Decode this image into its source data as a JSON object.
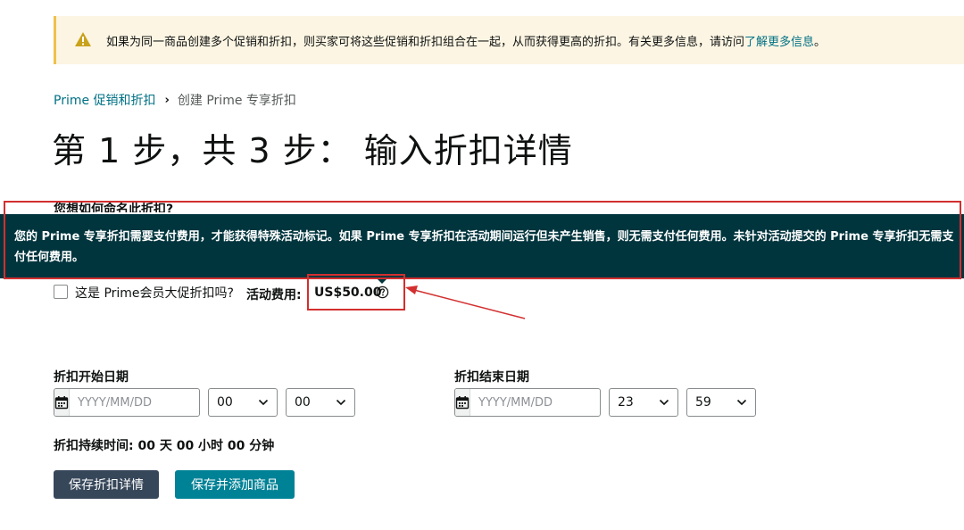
{
  "alert": {
    "text": "如果为同一商品创建多个促销和折扣，则买家可将这些促销和折扣组合在一起，从而获得更高的折扣。有关更多信息，请访问",
    "link": "了解更多信息",
    "suffix": "。",
    "icon": "warning-icon",
    "accent_color": "#f0c14b"
  },
  "breadcrumb": {
    "parent": "Prime 促销和折扣",
    "current": "创建 Prime 专享折扣"
  },
  "page_title": "第 1 步，共 3 步： 输入折扣详情",
  "form": {
    "name_label": "您想如何命名此折扣?",
    "tooltip": "您的 Prime 专享折扣需要支付费用，才能获得特殊活动标记。如果 Prime 专享折扣在活动期间运行但未产生销售，则无需支付任何费用。未针对活动提交的 Prime 专享折扣无需支付任何费用。",
    "prime_event_label": "这是 Prime会员大促折扣吗?",
    "fee_label": "活动费用:",
    "fee_value": "US$50.00",
    "start": {
      "label": "折扣开始日期",
      "placeholder": "YYYY/MM/DD",
      "hour": "00",
      "minute": "00"
    },
    "end": {
      "label": "折扣结束日期",
      "placeholder": "YYYY/MM/DD",
      "hour": "23",
      "minute": "59"
    },
    "duration": "折扣持续时间: 00 天 00 小时 00 分钟"
  },
  "buttons": {
    "save_details": "保存折扣详情",
    "save_add": "保存并添加商品"
  },
  "colors": {
    "link": "#007185",
    "tooltip_bg": "#00353e",
    "annotation": "#d32f2f",
    "primary_button": "#37475a",
    "secondary_button": "#008296"
  }
}
